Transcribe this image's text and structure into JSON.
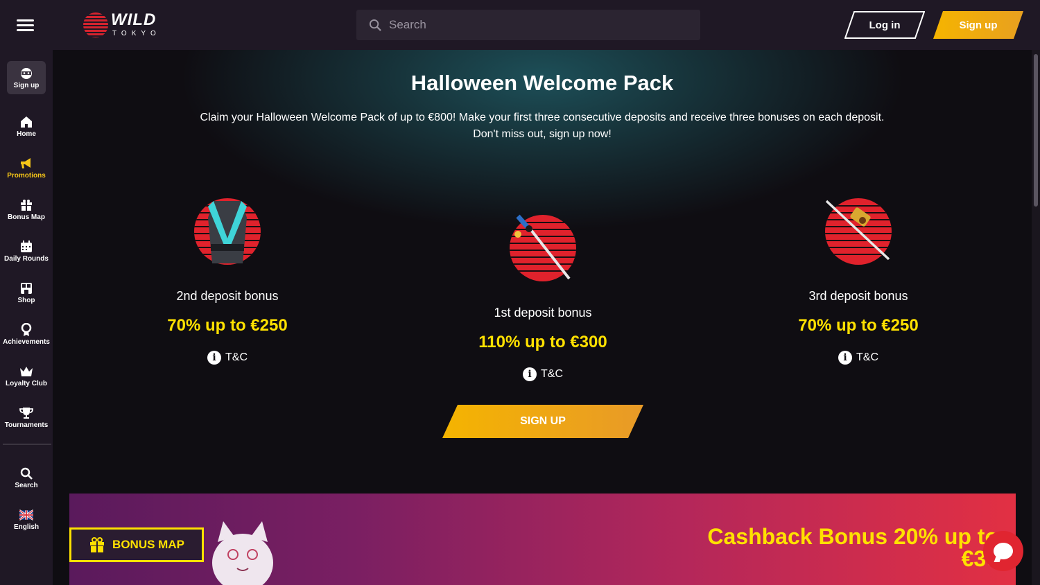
{
  "header": {
    "logo_text": "WILD",
    "logo_subtext": "TOKYO",
    "search_placeholder": "Search",
    "login_label": "Log in",
    "signup_label": "Sign up"
  },
  "sidebar": {
    "items": [
      {
        "label": "Sign up",
        "icon": "ninja-icon"
      },
      {
        "label": "Home",
        "icon": "home-icon"
      },
      {
        "label": "Promotions",
        "icon": "megaphone-icon"
      },
      {
        "label": "Bonus Map",
        "icon": "gift-icon"
      },
      {
        "label": "Daily Rounds",
        "icon": "calendar-icon"
      },
      {
        "label": "Shop",
        "icon": "shop-icon"
      },
      {
        "label": "Achievements",
        "icon": "medal-icon"
      },
      {
        "label": "Loyalty Club",
        "icon": "crown-icon"
      },
      {
        "label": "Tournaments",
        "icon": "trophy-icon"
      },
      {
        "label": "Search",
        "icon": "search-icon"
      },
      {
        "label": "English",
        "icon": "uk-flag-icon"
      }
    ]
  },
  "promo": {
    "title": "Halloween Welcome Pack",
    "description": "Claim your Halloween Welcome Pack of up to €800! Make your first three consecutive deposits and receive three bonuses on each deposit. Don't miss out, sign up now!",
    "bonuses": [
      {
        "name": "2nd deposit bonus",
        "amount": "70% up to €250",
        "tc": "T&C"
      },
      {
        "name": "1st deposit bonus",
        "amount": "110% up to €300",
        "tc": "T&C"
      },
      {
        "name": "3rd deposit bonus",
        "amount": "70% up to €250",
        "tc": "T&C"
      }
    ],
    "cta_label": "SIGN UP"
  },
  "banner": {
    "bonus_map_label": "BONUS MAP",
    "cashback_line1": "Cashback Bonus 20% up to",
    "cashback_line2": "€30"
  },
  "colors": {
    "accent_yellow": "#ffe100",
    "brand_red": "#d5232e",
    "topbar_bg": "#1f1825"
  }
}
